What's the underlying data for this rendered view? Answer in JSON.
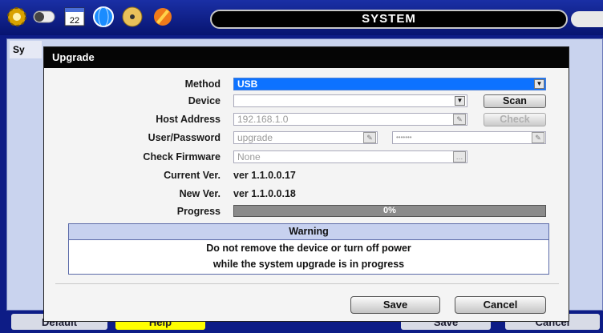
{
  "topbar": {
    "title": "SYSTEM",
    "calendar_date": "22",
    "icons": [
      "gear-icon",
      "toggle-icon",
      "calendar-icon",
      "globe-icon",
      "disc-icon",
      "tools-icon"
    ]
  },
  "background": {
    "tab_label": "Sy",
    "buttons": {
      "default": "Default",
      "help": "Help",
      "save": "Save",
      "cancel": "Cancel"
    }
  },
  "dialog": {
    "title": "Upgrade",
    "method": {
      "label": "Method",
      "value": "USB"
    },
    "device": {
      "label": "Device",
      "value": "",
      "scan_label": "Scan"
    },
    "host_address": {
      "label": "Host Address",
      "value": "192.168.1.0",
      "check_label": "Check"
    },
    "user_password": {
      "label": "User/Password",
      "user": "upgrade",
      "password": "•••••••"
    },
    "check_firmware": {
      "label": "Check Firmware",
      "value": "None"
    },
    "current_ver": {
      "label": "Current Ver.",
      "value": "ver 1.1.0.0.17"
    },
    "new_ver": {
      "label": "New Ver.",
      "value": "ver 1.1.0.0.18"
    },
    "progress": {
      "label": "Progress",
      "text": "0%",
      "fraction": 0
    },
    "warning": {
      "title": "Warning",
      "line1": "Do not remove the device or turn off power",
      "line2": "while the system upgrade is in progress"
    },
    "buttons": {
      "save": "Save",
      "cancel": "Cancel"
    }
  },
  "colors": {
    "accent_blue": "#0d72ff",
    "background": "#0d1c86",
    "help_yellow": "#ffff00"
  }
}
